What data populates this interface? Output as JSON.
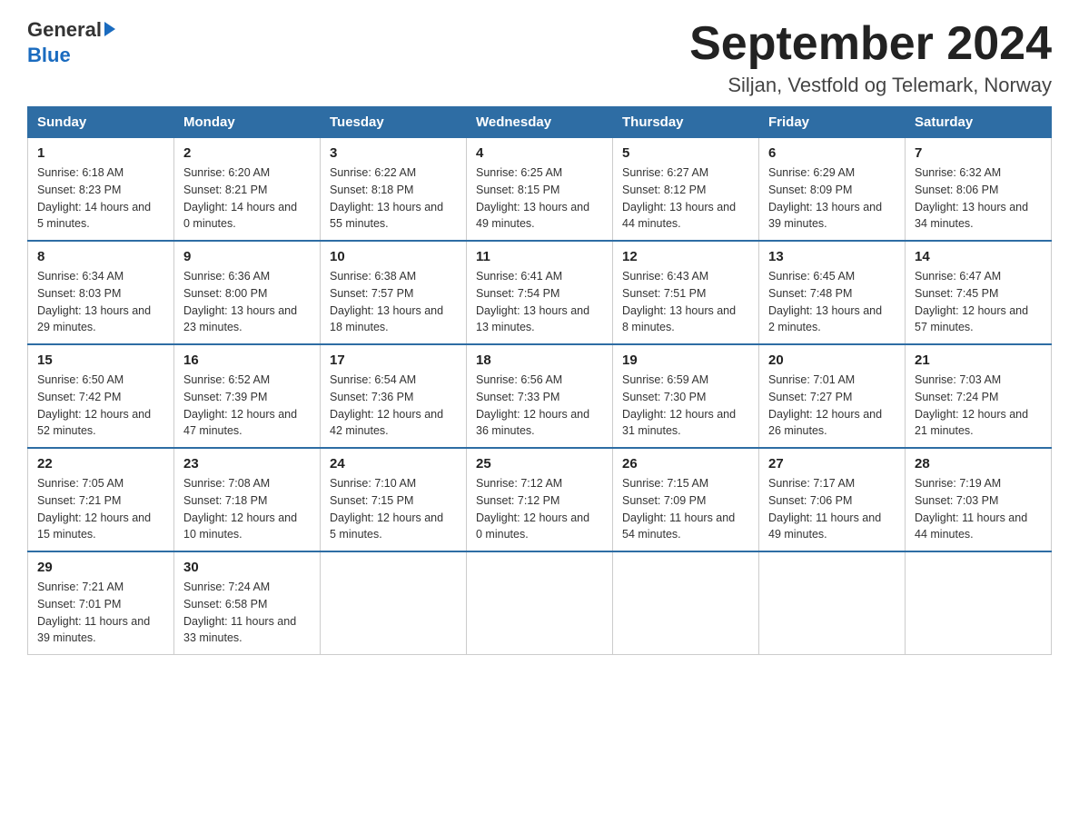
{
  "logo": {
    "general_text": "General",
    "blue_text": "Blue"
  },
  "title": "September 2024",
  "subtitle": "Siljan, Vestfold og Telemark, Norway",
  "weekdays": [
    "Sunday",
    "Monday",
    "Tuesday",
    "Wednesday",
    "Thursday",
    "Friday",
    "Saturday"
  ],
  "weeks": [
    [
      {
        "day": "1",
        "sunrise": "6:18 AM",
        "sunset": "8:23 PM",
        "daylight": "14 hours and 5 minutes."
      },
      {
        "day": "2",
        "sunrise": "6:20 AM",
        "sunset": "8:21 PM",
        "daylight": "14 hours and 0 minutes."
      },
      {
        "day": "3",
        "sunrise": "6:22 AM",
        "sunset": "8:18 PM",
        "daylight": "13 hours and 55 minutes."
      },
      {
        "day": "4",
        "sunrise": "6:25 AM",
        "sunset": "8:15 PM",
        "daylight": "13 hours and 49 minutes."
      },
      {
        "day": "5",
        "sunrise": "6:27 AM",
        "sunset": "8:12 PM",
        "daylight": "13 hours and 44 minutes."
      },
      {
        "day": "6",
        "sunrise": "6:29 AM",
        "sunset": "8:09 PM",
        "daylight": "13 hours and 39 minutes."
      },
      {
        "day": "7",
        "sunrise": "6:32 AM",
        "sunset": "8:06 PM",
        "daylight": "13 hours and 34 minutes."
      }
    ],
    [
      {
        "day": "8",
        "sunrise": "6:34 AM",
        "sunset": "8:03 PM",
        "daylight": "13 hours and 29 minutes."
      },
      {
        "day": "9",
        "sunrise": "6:36 AM",
        "sunset": "8:00 PM",
        "daylight": "13 hours and 23 minutes."
      },
      {
        "day": "10",
        "sunrise": "6:38 AM",
        "sunset": "7:57 PM",
        "daylight": "13 hours and 18 minutes."
      },
      {
        "day": "11",
        "sunrise": "6:41 AM",
        "sunset": "7:54 PM",
        "daylight": "13 hours and 13 minutes."
      },
      {
        "day": "12",
        "sunrise": "6:43 AM",
        "sunset": "7:51 PM",
        "daylight": "13 hours and 8 minutes."
      },
      {
        "day": "13",
        "sunrise": "6:45 AM",
        "sunset": "7:48 PM",
        "daylight": "13 hours and 2 minutes."
      },
      {
        "day": "14",
        "sunrise": "6:47 AM",
        "sunset": "7:45 PM",
        "daylight": "12 hours and 57 minutes."
      }
    ],
    [
      {
        "day": "15",
        "sunrise": "6:50 AM",
        "sunset": "7:42 PM",
        "daylight": "12 hours and 52 minutes."
      },
      {
        "day": "16",
        "sunrise": "6:52 AM",
        "sunset": "7:39 PM",
        "daylight": "12 hours and 47 minutes."
      },
      {
        "day": "17",
        "sunrise": "6:54 AM",
        "sunset": "7:36 PM",
        "daylight": "12 hours and 42 minutes."
      },
      {
        "day": "18",
        "sunrise": "6:56 AM",
        "sunset": "7:33 PM",
        "daylight": "12 hours and 36 minutes."
      },
      {
        "day": "19",
        "sunrise": "6:59 AM",
        "sunset": "7:30 PM",
        "daylight": "12 hours and 31 minutes."
      },
      {
        "day": "20",
        "sunrise": "7:01 AM",
        "sunset": "7:27 PM",
        "daylight": "12 hours and 26 minutes."
      },
      {
        "day": "21",
        "sunrise": "7:03 AM",
        "sunset": "7:24 PM",
        "daylight": "12 hours and 21 minutes."
      }
    ],
    [
      {
        "day": "22",
        "sunrise": "7:05 AM",
        "sunset": "7:21 PM",
        "daylight": "12 hours and 15 minutes."
      },
      {
        "day": "23",
        "sunrise": "7:08 AM",
        "sunset": "7:18 PM",
        "daylight": "12 hours and 10 minutes."
      },
      {
        "day": "24",
        "sunrise": "7:10 AM",
        "sunset": "7:15 PM",
        "daylight": "12 hours and 5 minutes."
      },
      {
        "day": "25",
        "sunrise": "7:12 AM",
        "sunset": "7:12 PM",
        "daylight": "12 hours and 0 minutes."
      },
      {
        "day": "26",
        "sunrise": "7:15 AM",
        "sunset": "7:09 PM",
        "daylight": "11 hours and 54 minutes."
      },
      {
        "day": "27",
        "sunrise": "7:17 AM",
        "sunset": "7:06 PM",
        "daylight": "11 hours and 49 minutes."
      },
      {
        "day": "28",
        "sunrise": "7:19 AM",
        "sunset": "7:03 PM",
        "daylight": "11 hours and 44 minutes."
      }
    ],
    [
      {
        "day": "29",
        "sunrise": "7:21 AM",
        "sunset": "7:01 PM",
        "daylight": "11 hours and 39 minutes."
      },
      {
        "day": "30",
        "sunrise": "7:24 AM",
        "sunset": "6:58 PM",
        "daylight": "11 hours and 33 minutes."
      },
      null,
      null,
      null,
      null,
      null
    ]
  ]
}
